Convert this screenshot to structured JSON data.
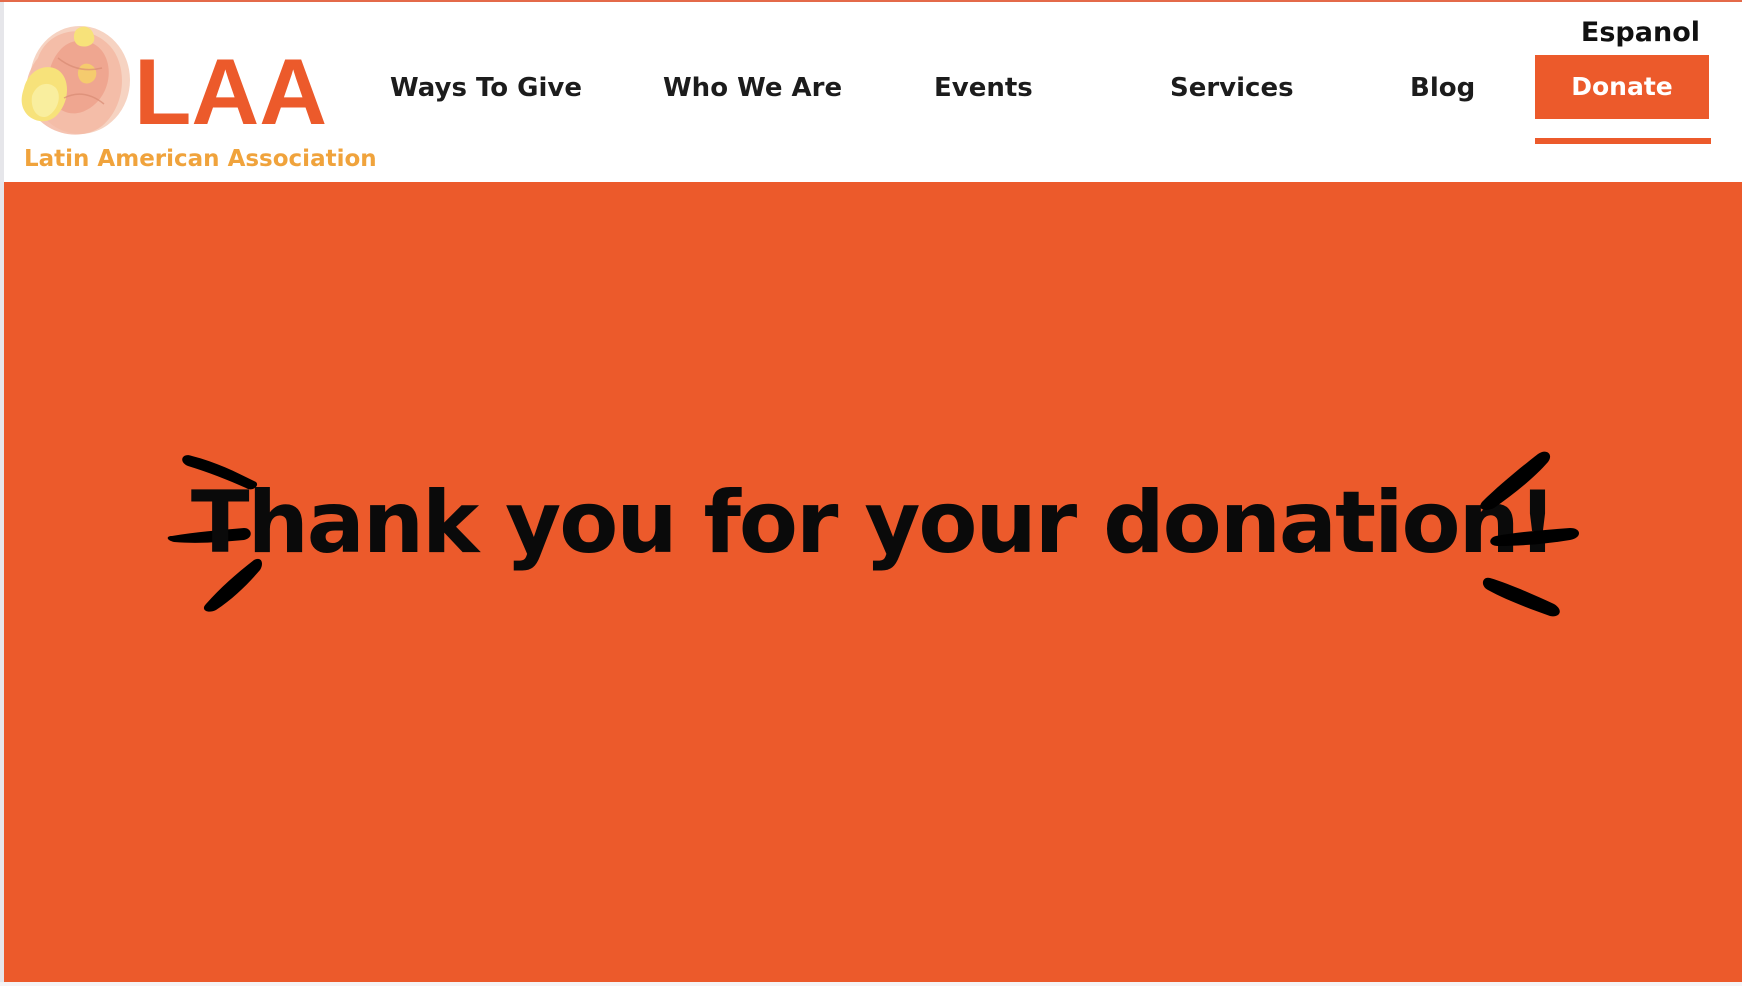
{
  "header": {
    "logo": {
      "mark": "LAA",
      "tagline": "Latin American Association",
      "icon": "flower-illustration"
    },
    "nav": [
      {
        "label": "Ways To Give"
      },
      {
        "label": "Who We Are"
      },
      {
        "label": "Events"
      },
      {
        "label": "Services"
      },
      {
        "label": "Blog"
      }
    ],
    "language_link": "Espanol",
    "donate_label": "Donate"
  },
  "hero": {
    "heading": "Thank you for your donation!",
    "decoration_icons": [
      "burst-lines-left-icon",
      "burst-lines-right-icon"
    ]
  },
  "colors": {
    "brand_orange": "#ec5a2b",
    "tagline_gold": "#f0a33c",
    "text_dark": "#1c1c1c",
    "white": "#ffffff"
  }
}
